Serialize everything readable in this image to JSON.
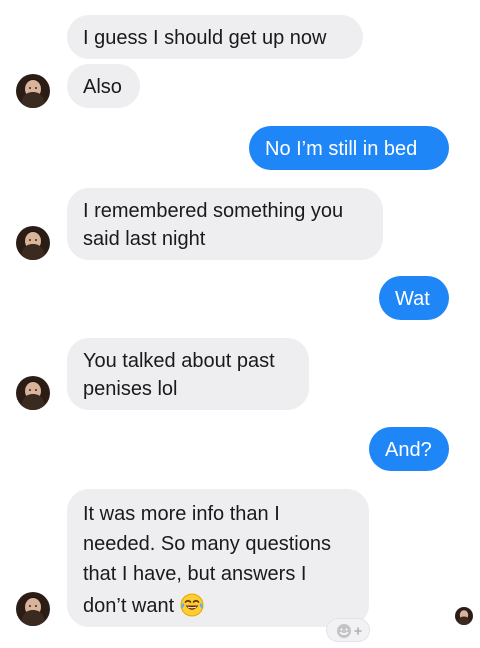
{
  "messages": [
    {
      "side": "incoming",
      "text": "I guess I should get up now"
    },
    {
      "side": "incoming",
      "text": "Also"
    },
    {
      "side": "outgoing",
      "text": "No I’m still in bed"
    },
    {
      "side": "incoming",
      "lines": [
        "I remembered something you",
        "said last night"
      ]
    },
    {
      "side": "outgoing",
      "text": "Wat"
    },
    {
      "side": "incoming",
      "lines": [
        "You talked about past",
        "penises lol"
      ]
    },
    {
      "side": "outgoing",
      "text": "And?"
    },
    {
      "side": "incoming",
      "lines": [
        "It was more info than I",
        "needed. So many questions",
        "that I have, but answers I",
        "don’t want"
      ],
      "emoji": "face-with-tears-of-joy"
    }
  ],
  "icons": {
    "contact_avatar": "contact-avatar",
    "read_receipt": "read-receipt-avatar",
    "add_reaction": "add-reaction-icon"
  },
  "colors": {
    "incoming_bubble": "#eeeef0",
    "outgoing_bubble": "#1f86f7",
    "incoming_text": "#1a1a1a",
    "outgoing_text": "#ffffff"
  }
}
